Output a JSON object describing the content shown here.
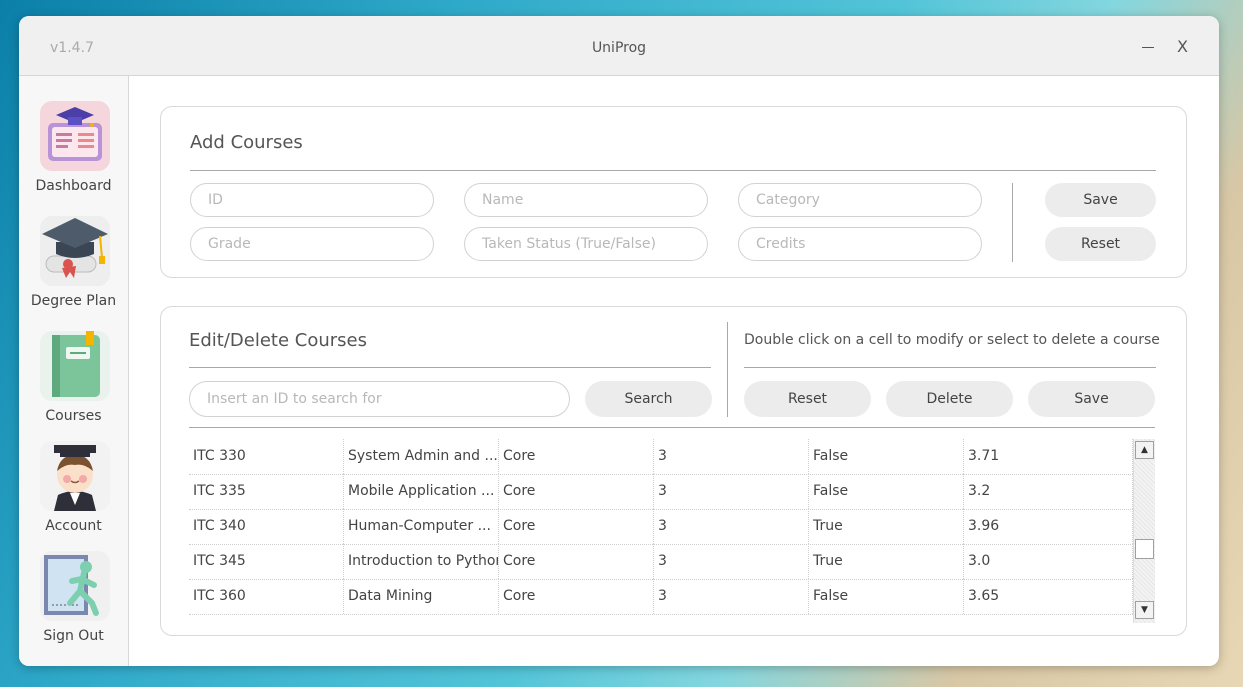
{
  "window": {
    "version": "v1.4.7",
    "title": "UniProg",
    "minimize_label": "–",
    "close_label": "X"
  },
  "sidebar": {
    "items": [
      {
        "label": "Dashboard",
        "icon": "dashboard-icon"
      },
      {
        "label": "Degree Plan",
        "icon": "graduation-cap-icon"
      },
      {
        "label": "Courses",
        "icon": "book-icon"
      },
      {
        "label": "Account",
        "icon": "avatar-icon"
      },
      {
        "label": "Sign Out",
        "icon": "sign-out-icon"
      }
    ]
  },
  "add_courses": {
    "title": "Add Courses",
    "id_placeholder": "ID",
    "name_placeholder": "Name",
    "category_placeholder": "Category",
    "grade_placeholder": "Grade",
    "taken_placeholder": "Taken Status (True/False)",
    "credits_placeholder": "Credits",
    "save_label": "Save",
    "reset_label": "Reset"
  },
  "edit_courses": {
    "title": "Edit/Delete Courses",
    "hint": "Double click on a cell to modify or select to delete a course",
    "search_placeholder": "Insert an ID to search for",
    "search_label": "Search",
    "reset_label": "Reset",
    "delete_label": "Delete",
    "save_label": "Save"
  },
  "table": {
    "rows": [
      [
        "ITC 330",
        "System Admin and ...",
        "Core",
        "3",
        "False",
        "3.71"
      ],
      [
        "ITC 335",
        "Mobile Application ...",
        "Core",
        "3",
        "False",
        "3.2"
      ],
      [
        "ITC 340",
        "Human-Computer ...",
        "Core",
        "3",
        "True",
        "3.96"
      ],
      [
        "ITC 345",
        "Introduction to Python",
        "Core",
        "3",
        "True",
        "3.0"
      ],
      [
        "ITC 360",
        "Data Mining",
        "Core",
        "3",
        "False",
        "3.65"
      ]
    ],
    "scroll_up": "▲",
    "scroll_down": "▼"
  },
  "colors": {
    "panel_border": "#d9d9d9",
    "button_bg": "#ececec",
    "titlebar_bg": "#f0f0f0"
  }
}
